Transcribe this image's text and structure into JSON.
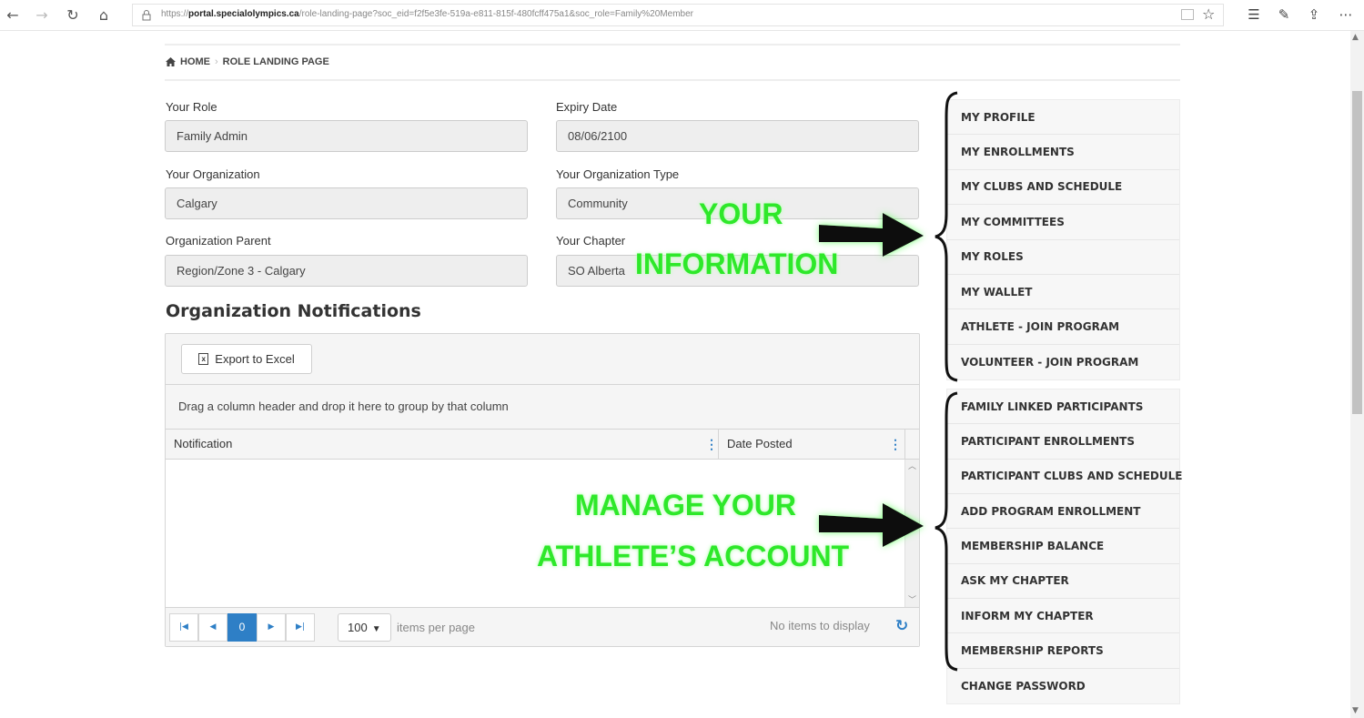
{
  "browser": {
    "url_domain": "portal.specialolympics.ca",
    "url_path": "/role-landing-page?soc_eid=f2f5e3fe-519a-e811-815f-480fcff475a1&soc_role=Family%20Member",
    "url_scheme": "https://"
  },
  "breadcrumb": {
    "home": "HOME",
    "current": "ROLE LANDING PAGE"
  },
  "fields": {
    "role_label": "Your Role",
    "role_value": "Family Admin",
    "expiry_label": "Expiry Date",
    "expiry_value": "08/06/2100",
    "org_label": "Your Organization",
    "org_value": "Calgary",
    "org_type_label": "Your Organization Type",
    "org_type_value": "Community",
    "org_parent_label": "Organization Parent",
    "org_parent_value": "Region/Zone 3 - Calgary",
    "chapter_label": "Your Chapter",
    "chapter_value": "SO Alberta"
  },
  "notifications": {
    "title": "Organization Notifications",
    "export_label": "Export to Excel",
    "group_hint": "Drag a column header and drop it here to group by that column",
    "columns": [
      "Notification",
      "Date Posted"
    ],
    "rows": [],
    "pager": {
      "current_page": "0",
      "page_size": "100",
      "items_per_page_label": "items per page",
      "empty_label": "No items to display"
    }
  },
  "menu": {
    "group_a": [
      "MY PROFILE",
      "MY ENROLLMENTS",
      "MY CLUBS AND SCHEDULE",
      "MY COMMITTEES",
      "MY ROLES",
      "MY WALLET",
      "ATHLETE - JOIN PROGRAM",
      "VOLUNTEER - JOIN PROGRAM"
    ],
    "group_b": [
      "FAMILY LINKED PARTICIPANTS",
      "PARTICIPANT ENROLLMENTS",
      "PARTICIPANT CLUBS AND SCHEDULE",
      "ADD PROGRAM ENROLLMENT",
      "MEMBERSHIP BALANCE",
      "ASK MY CHAPTER",
      "INFORM MY CHAPTER",
      "MEMBERSHIP REPORTS",
      "CHANGE PASSWORD"
    ]
  },
  "annotations": {
    "info_line1": "YOUR",
    "info_line2": "INFORMATION",
    "athlete_line1": "MANAGE YOUR",
    "athlete_line2": "ATHLETE’S ACCOUNT",
    "color": "#2ee82a"
  },
  "colors": {
    "accent": "#2e7fc6",
    "field_bg": "#eeeeee",
    "menu_bg": "#f7f7f7"
  }
}
